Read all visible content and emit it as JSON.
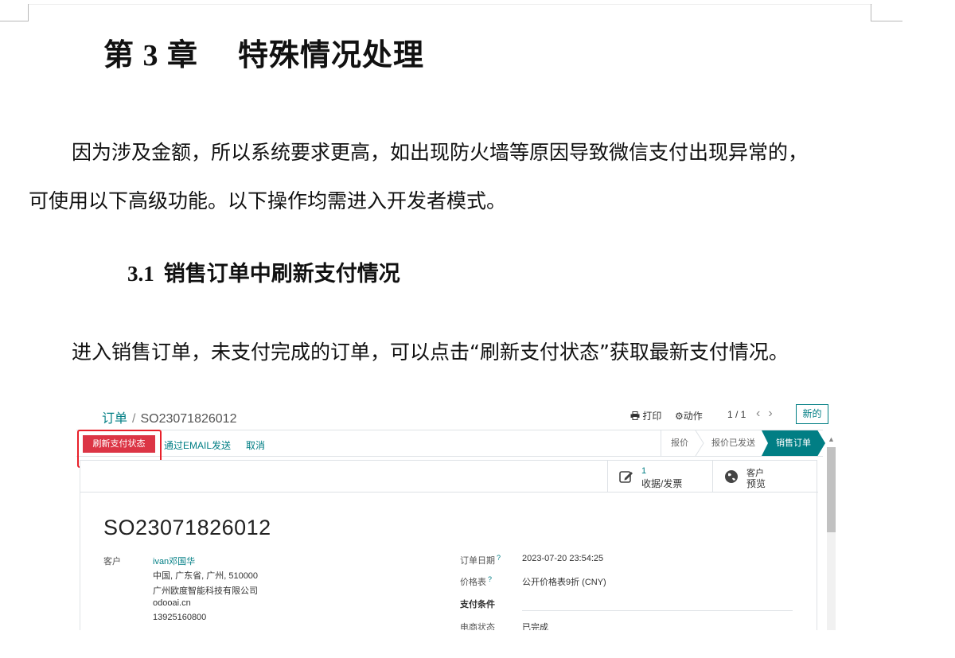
{
  "doc": {
    "chapter_num": "第 3 章",
    "chapter_title": "特殊情况处理",
    "para1": "因为涉及金额，所以系统要求更高，如出现防火墙等原因导致微信支付出现异常的，",
    "para2": "可使用以下高级功能。以下操作均需进入开发者模式。",
    "section_num": "3.1",
    "section_title": "销售订单中刷新支付情况",
    "para3": "进入销售订单，未支付完成的订单，可以点击“刷新支付状态”获取最新支付情况。"
  },
  "shot": {
    "breadcrumb": {
      "parent": "订单",
      "sep": "/",
      "current": "SO23071826012"
    },
    "print": "打印",
    "action": "动作",
    "pager": "1 / 1",
    "new_button": "新的",
    "refresh_button": "刷新支付状态",
    "email_button": "通过EMAIL发送",
    "cancel_button": "取消",
    "stages": [
      "报价",
      "报价已发送",
      "销售订单"
    ],
    "smart_invoice": {
      "count": "1",
      "label": "收据/发票"
    },
    "smart_preview": {
      "line1": "客户",
      "line2": "预览"
    },
    "order_title": "SO23071826012",
    "customer_label": "客户",
    "customer_name": "ivan邓国华",
    "customer_addr1": "中国, 广东省, 广州, 510000",
    "customer_company": "广州欧度智能科技有限公司",
    "customer_site": "odooai.cn",
    "customer_phone": "13925160800",
    "order_date_label": "订单日期",
    "order_date": "2023-07-20 23:54:25",
    "pricelist_label": "价格表",
    "pricelist": "公开价格表9折 (CNY)",
    "payment_terms_label": "支付条件",
    "ecom_status_label": "电商状态",
    "ecom_status": "已完成",
    "req_mark": "?",
    "colors": {
      "accent": "#017e84",
      "danger": "#dc3545",
      "highlight": "#e8202a"
    }
  }
}
